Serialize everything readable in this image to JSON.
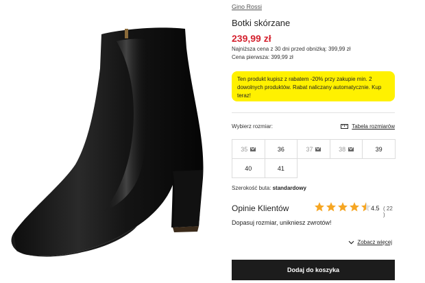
{
  "product": {
    "brand": "Gino Rossi",
    "title": "Botki skórzane",
    "price": "239,99 zł",
    "lowest_price_note": "Najniższa cena z 30 dni przed obniżką: 399,99 zł",
    "first_price_note": "Cena pierwsza: 399,99 zł"
  },
  "promo": {
    "text": "Ten produkt kupisz z rabatem -20% przy zakupie min. 2 dowolnych produktów. Rabat naliczany automatycznie. Kup teraz!",
    "color": "#fff100"
  },
  "size": {
    "label": "Wybierz rozmiar:",
    "table_link": "Tabela rozmiarów",
    "options": [
      {
        "size": "35",
        "available": false
      },
      {
        "size": "36",
        "available": true
      },
      {
        "size": "37",
        "available": false
      },
      {
        "size": "38",
        "available": false
      },
      {
        "size": "39",
        "available": true
      },
      {
        "size": "40",
        "available": true
      },
      {
        "size": "41",
        "available": true
      }
    ]
  },
  "width": {
    "label": "Szerokość buta:",
    "value": "standardowy"
  },
  "reviews": {
    "title": "Opinie Klientów",
    "rating": "4.5",
    "count": "( 22 )",
    "stars_value": 4.5,
    "star_color": "#f6a623",
    "promo_text": "Dopasuj rozmiar, unikniesz zwrotów!",
    "see_more": "Zobacz więcej"
  },
  "cart": {
    "button_label": "Dodaj do koszyka"
  },
  "colors": {
    "price": "#d4212e",
    "button": "#1c1c1c"
  }
}
